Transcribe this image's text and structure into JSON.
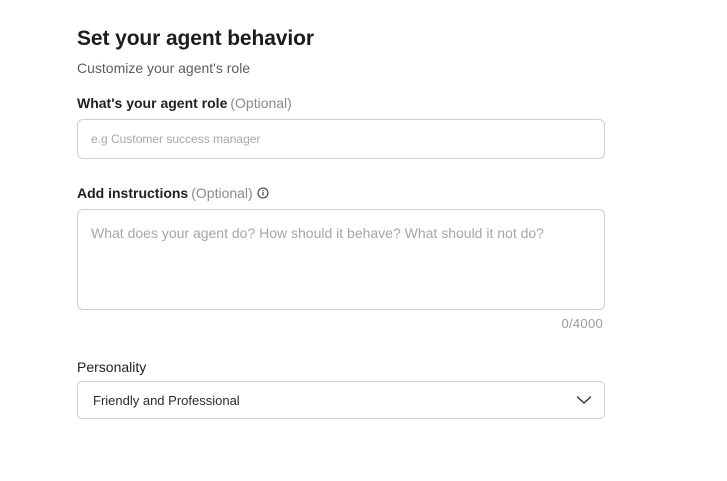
{
  "header": {
    "title": "Set your agent behavior",
    "subtitle": "Customize your agent's role"
  },
  "role_field": {
    "label": "What's your agent role",
    "optional": "(Optional)",
    "placeholder": "e.g Customer success manager",
    "value": ""
  },
  "instructions_field": {
    "label": "Add instructions",
    "optional": "(Optional)",
    "info_icon": "info-circle-icon",
    "placeholder": "What does your agent do? How should it behave? What should it not do?",
    "value": "",
    "counter": "0/4000"
  },
  "personality_field": {
    "label": "Personality",
    "selected": "Friendly and Professional",
    "dropdown_icon": "chevron-down-icon"
  }
}
